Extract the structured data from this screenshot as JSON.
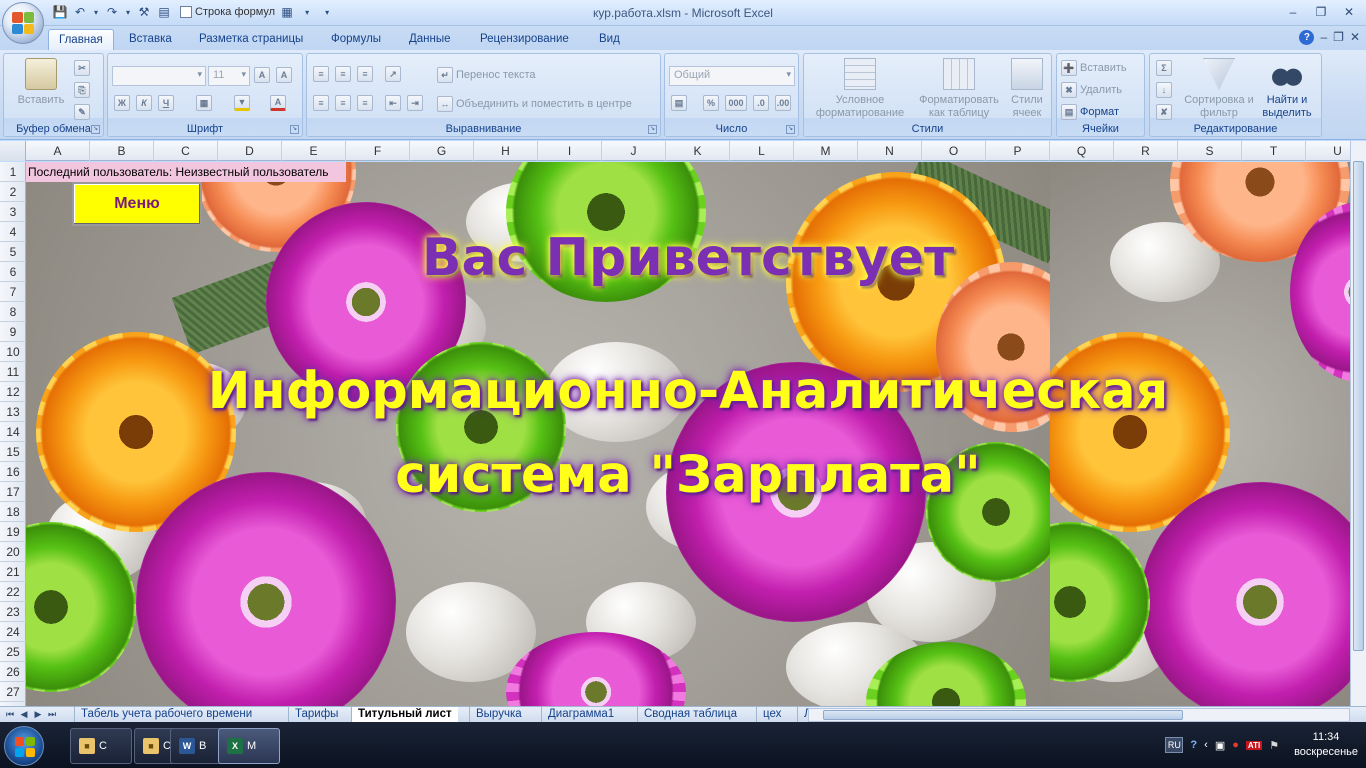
{
  "window": {
    "title": "кур.работа.xlsm - Microsoft Excel",
    "qat_checkbox_label": "Строка формул"
  },
  "tabs": [
    "Главная",
    "Вставка",
    "Разметка страницы",
    "Формулы",
    "Данные",
    "Рецензирование",
    "Вид"
  ],
  "ribbon": {
    "clipboard": {
      "label": "Буфер обмена",
      "paste": "Вставить"
    },
    "font": {
      "label": "Шрифт",
      "size": "11"
    },
    "alignment": {
      "label": "Выравнивание",
      "wrap": "Перенос текста",
      "merge": "Объединить и поместить в центре"
    },
    "number": {
      "label": "Число",
      "format": "Общий",
      "percent": "%",
      "thousands": "000"
    },
    "styles": {
      "label": "Стили",
      "conditional": "Условное форматирование",
      "as_table": "Форматировать как таблицу",
      "cell_styles": "Стили ячеек"
    },
    "cells": {
      "label": "Ячейки",
      "insert": "Вставить",
      "delete": "Удалить",
      "format": "Формат"
    },
    "editing": {
      "label": "Редактирование",
      "sort": "Сортировка и фильтр",
      "find": "Найти и выделить"
    }
  },
  "grid": {
    "columns": [
      "A",
      "B",
      "C",
      "D",
      "E",
      "F",
      "G",
      "H",
      "I",
      "J",
      "K",
      "L",
      "M",
      "N",
      "O",
      "P",
      "Q",
      "R",
      "S",
      "T",
      "U"
    ],
    "rows": [
      "1",
      "2",
      "3",
      "4",
      "5",
      "6",
      "7",
      "8",
      "9",
      "10",
      "11",
      "12",
      "13",
      "14",
      "15",
      "16",
      "17",
      "18",
      "19",
      "20",
      "21",
      "22",
      "23",
      "24",
      "25",
      "26",
      "27"
    ]
  },
  "sheet": {
    "cell_a1": "Последний пользователь: Неизвестный пользователь",
    "menu_button": "Меню",
    "welcome": "Вас Приветствует",
    "system_line1": "Информационно-Аналитическая",
    "system_line2": "система \"Зарплата\""
  },
  "sheet_tabs": [
    "Табель учета рабочего времени",
    "Тарифы",
    "Титульный лист",
    "Выручка",
    "Диаграмма1",
    "Сводная таблица",
    "цех",
    "Л"
  ],
  "active_sheet_tab": "Титульный лист",
  "taskbar": {
    "items": [
      "С",
      "С",
      "В",
      "М"
    ],
    "lang": "RU",
    "time": "11:34",
    "day": "воскресенье"
  },
  "colors": {
    "a1_fill": "#f2c6df",
    "menu_fill": "#ffff00",
    "welcome_text": "#7b2fb3",
    "system_text": "#ffff1a"
  }
}
